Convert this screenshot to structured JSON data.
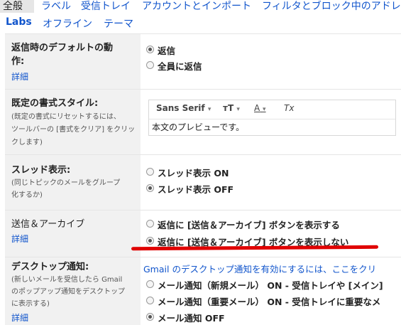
{
  "tabs": {
    "row1": [
      "全般",
      "ラベル",
      "受信トレイ",
      "アカウントとインポート",
      "フィルタとブロック中のアドレ"
    ],
    "row2": [
      "Labs",
      "オフライン",
      "テーマ"
    ]
  },
  "reply_default": {
    "title_line1": "返信時のデフォルトの動",
    "title_line2": "作:",
    "link": "詳細",
    "options": [
      "返信",
      "全員に返信"
    ]
  },
  "text_style": {
    "title": "既定の書式スタイル:",
    "desc_line1": "(既定の書式にリセットするには、",
    "desc_line2": "ツールバーの [書式をクリア] をクリッ",
    "desc_line3": "クします)",
    "toolbar": {
      "font": "Sans Serif",
      "size_icon": "тT",
      "color_icon": "A",
      "clear_icon": "Tx"
    },
    "preview": "本文のプレビューです。"
  },
  "thread_view": {
    "title": "スレッド表示:",
    "desc_line1": "(同じトピックのメールをグループ",
    "desc_line2": "化するか)",
    "options": [
      "スレッド表示 ON",
      "スレッド表示 OFF"
    ]
  },
  "send_archive": {
    "title": "送信＆アーカイブ",
    "link": "詳細",
    "options": [
      "返信に [送信＆アーカイブ] ボタンを表示する",
      "返信に [送信＆アーカイブ] ボタンを表示しない"
    ]
  },
  "desktop_notifications": {
    "title": "デスクトップ通知:",
    "desc_line1": "(新しいメールを受信したら Gmail",
    "desc_line2": "のポップアップ通知をデスクトップ",
    "desc_line3": "に表示する)",
    "link": "詳細",
    "enable_text": "Gmail のデスクトップ通知を有効にするには、ここをクリ",
    "options": [
      "メール通知（新規メール） ON - 受信トレイや [メイン]",
      "メール通知（重要メール） ON - 受信トレイに重要なメ",
      "メール通知 OFF"
    ]
  },
  "colors": {
    "link": "#1155cc",
    "annotation": "#e00000",
    "label_bg": "#f1f1f1"
  }
}
